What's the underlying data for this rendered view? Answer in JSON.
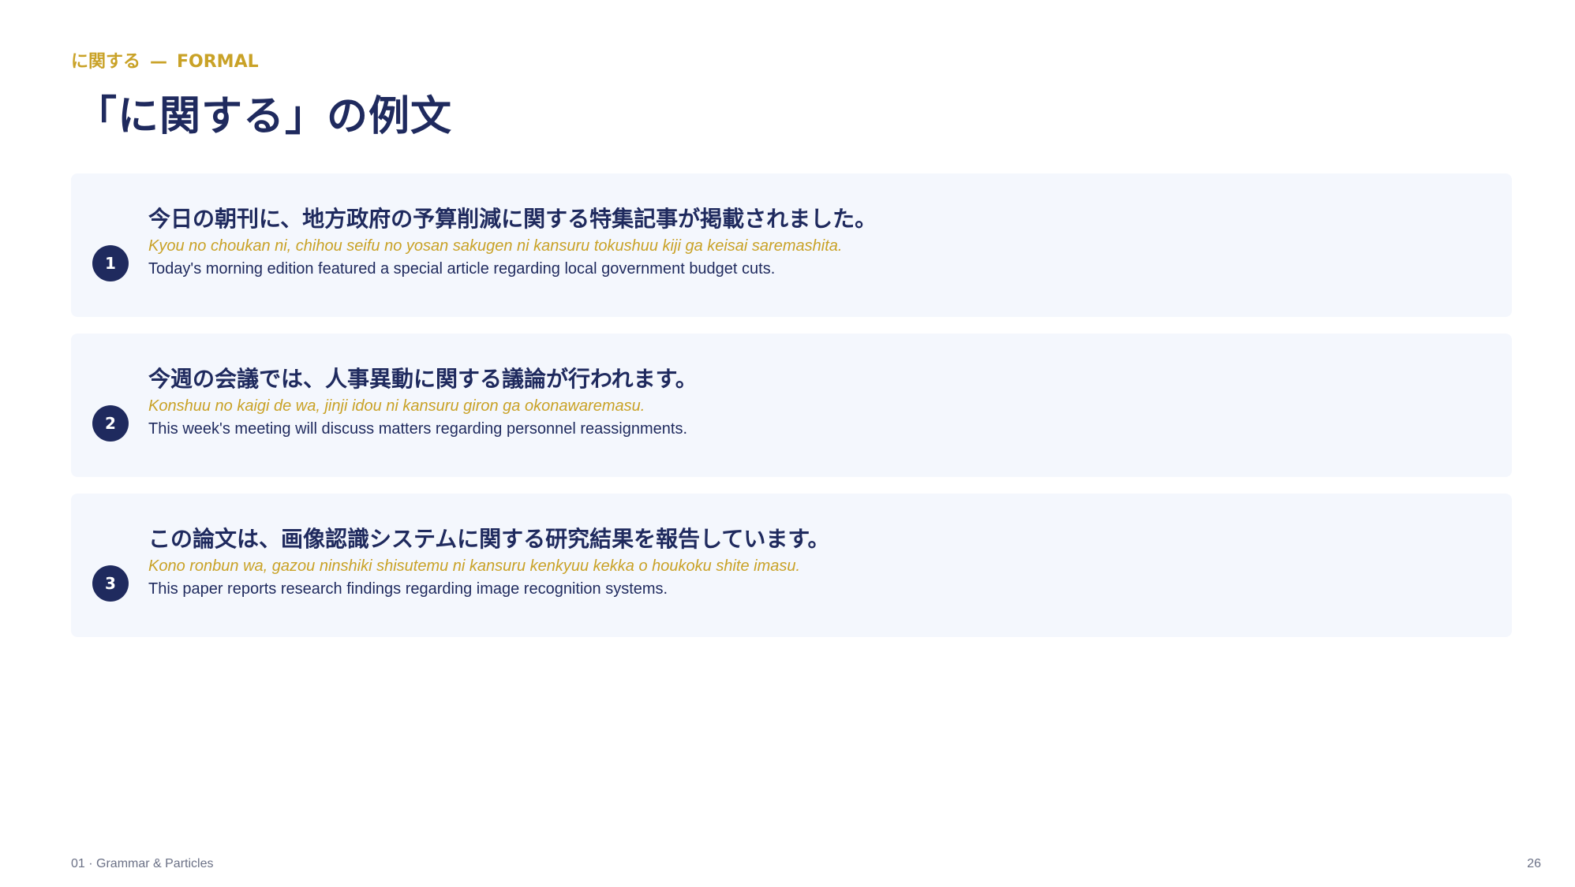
{
  "header": {
    "eyebrow_term": "に関する",
    "eyebrow_sep": "—",
    "eyebrow_register": "FORMAL",
    "title": "「に関する」の例文"
  },
  "examples": [
    {
      "number": "1",
      "japanese": "今日の朝刊に、地方政府の予算削減に関する特集記事が掲載されました。",
      "romaji": "Kyou no choukan ni, chihou seifu no yosan sakugen ni kansuru tokushuu kiji ga keisai saremashita.",
      "english": "Today's morning edition featured a special article regarding local government budget cuts."
    },
    {
      "number": "2",
      "japanese": "今週の会議では、人事異動に関する議論が行われます。",
      "romaji": "Konshuu no kaigi de wa, jinji idou ni kansuru giron ga okonawaremasu.",
      "english": "This week's meeting will discuss matters regarding personnel reassignments."
    },
    {
      "number": "3",
      "japanese": "この論文は、画像認識システムに関する研究結果を報告しています。",
      "romaji": "Kono ronbun wa, gazou ninshiki shisutemu ni kansuru kenkyuu kekka o houkoku shite imasu.",
      "english": "This paper reports research findings regarding image recognition systems."
    }
  ],
  "footer": {
    "section": "01 · Grammar & Particles",
    "page_number": "26"
  },
  "colors": {
    "navy": "#1F2A5E",
    "gold": "#C9A227",
    "card_background": "#F4F7FD",
    "muted": "#6B7186"
  }
}
